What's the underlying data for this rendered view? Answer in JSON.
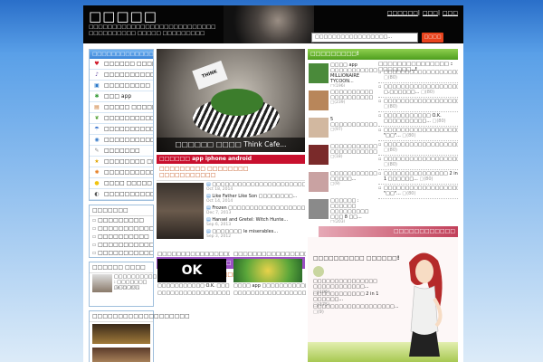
{
  "header": {
    "logo": "□□□□□",
    "tagline": "□□□□□□□□□□□□□□□□□□□□□□□□□□□ □□□□□□□□□□ □□□□□ □□□□□□□□□",
    "links": [
      "□□□□□□",
      "□□□",
      "□□□"
    ],
    "search_placeholder": "□□□□□□□□□□□□□□□□□...",
    "search_button": "□□□□"
  },
  "sidebar": {
    "title": "□□□□□□□□□□□□□",
    "items": [
      {
        "icon": "heart-icon",
        "glyph": "♥",
        "color": "#d11a2a",
        "label": "□□□□□□ □□□□"
      },
      {
        "icon": "music-note-icon",
        "glyph": "♪",
        "color": "#5a3c9c",
        "label": "□□□□□□□□□□"
      },
      {
        "icon": "image-icon",
        "glyph": "▣",
        "color": "#2a78c9",
        "label": "□□□□□□□□□"
      },
      {
        "icon": "apps-icon",
        "glyph": "✱",
        "color": "#3a9c3a",
        "label": "□□□ app"
      },
      {
        "icon": "book-icon",
        "glyph": "▤",
        "color": "#c9742a",
        "label": "□□□□□ □□□□□□□"
      },
      {
        "icon": "leaf-icon",
        "glyph": "❦",
        "color": "#4a9c2a",
        "label": "□□□□□□□□□□□"
      },
      {
        "icon": "umbrella-icon",
        "glyph": "☂",
        "color": "#2a68c9",
        "label": "□□□□□□□□□□□"
      },
      {
        "icon": "globe-icon",
        "glyph": "◉",
        "color": "#3a7cc9",
        "label": "□□□□□□□□□□□"
      },
      {
        "icon": "pin-icon",
        "glyph": "✎",
        "color": "#888888",
        "label": "□□□□□□□"
      },
      {
        "icon": "star-icon",
        "glyph": "★",
        "color": "#e0a400",
        "label": "□□□□□□□□ □□"
      },
      {
        "icon": "sun-icon",
        "glyph": "✺",
        "color": "#e67e22",
        "label": "□□□□□□□□□□□"
      },
      {
        "icon": "bulb-icon",
        "glyph": "●",
        "color": "#f1c40f",
        "label": "□□□□ □□□□□"
      },
      {
        "icon": "speaker-icon",
        "glyph": "◐",
        "color": "#555555",
        "label": "□□□□□□□□□□"
      }
    ]
  },
  "tags": {
    "title": "□□□□□□□",
    "items": [
      "□□□□□□□□□",
      "□□□□□□□□□□□□□□□",
      "□□□□□□□□□□",
      "□□□□□□□□□□□□□□□",
      "□□□□□□□□□□□□□"
    ]
  },
  "left_news": {
    "title": "□□□□□□ □□□□",
    "caption": "□□□□□□□□□□ : □□□□□□□ □□□□□□",
    "date": "Jan 25, 2010"
  },
  "left_video": {
    "title": "□□□□□□□□□□□□□□□□□□□"
  },
  "featured": {
    "caption": "□□□□□□ □□□□ Think Cafe..."
  },
  "redbar": "□□□□□□ app iphone android",
  "news": {
    "title": "□□□□□□□□□ □□□□□□□□ □□□□□□□□□□□",
    "items": [
      {
        "text": "□□□□□□□□□□□□□□□□□□□□□□□□□...",
        "date": "Oct 18, 2014"
      },
      {
        "text": "Like Father Like Son □□□□□□□□...",
        "date": "Oct 14, 2014"
      },
      {
        "text": "Frozen □□□□□□□□□□□□□□□□□□□...",
        "date": "Dec 7, 2013"
      },
      {
        "text": "Hansel and Gretel: Witch Hunte...",
        "date": "Sep 6, 2013"
      },
      {
        "text": "□□□□□□□ le miserables...",
        "date": "Sep 3, 2012"
      }
    ]
  },
  "purple_bar": "□□□□□□□□□□□□□□",
  "sub_header": "□□□□□□□□□□□□□□□□!",
  "bottom_left": {
    "title": "□□□□□□□□□□□□□□□□□□□",
    "rows": [
      "□□□□□□□□□□□ O.K. □□□□□□□□□□...",
      "□□□□□□□□□□□□□□□□□□□□□□..."
    ]
  },
  "bottom_right": {
    "title": "□□□□□□□□□□□□□□□□",
    "rows": [
      "□□□□ app □□□□□□□□□□□ MILLIONAIRE TYCOON...",
      "□□□□□□□□□□□□□□□□□□□□..."
    ]
  },
  "right": {
    "header": "□□□□□□□□□!",
    "col_a": [
      {
        "text": "□□□□ app □□□□□□□□□□□ MILLIONAIRE TYCOON...",
        "count": "□(196)"
      },
      {
        "text": "□□□□□□□□□□ □□□□□□□□□□",
        "count": "□(239)"
      },
      {
        "text": "5 □□□□□□□□□□□□□□□□□□□□□□□□□□□...",
        "count": "□(97)"
      },
      {
        "text": "□□□□□□□□□□□□□□ □□□□□□□□□□□□□...",
        "count": "□(18)"
      },
      {
        "text": "□□□□□□□□□□□□□□□ □□□□□...",
        "count": "□(9)"
      },
      {
        "text": "□□□□□□ : □□□□□□ □□□□□□□□□ □□□ 8 □□...",
        "count": "□(203)"
      }
    ],
    "col_b_title": "□□□□□□□□□□□□□□□ : □□□□□□□..!",
    "col_b": [
      {
        "text": "□□□□□□□□□□□□□□□□□□□□□□□□□□□□□□",
        "count": "□(80)"
      },
      {
        "text": "□□□□□□□□□□□□□□□□□□□ □.□□□□□□...",
        "count": "□(80)"
      },
      {
        "text": "□□□□□□□□□□□□□□□□□□□□□□□□□□□□□□□",
        "count": "□(80)"
      },
      {
        "text": "□□□□□□□□□□□ O.K. □□□□□□□□□□...",
        "count": "□(80)"
      },
      {
        "text": "□□□□□□□□□□□□□□□□□□□□□□□ \"□□\"...",
        "count": "□(80)"
      },
      {
        "text": "□□□□□□□□□□□□□□□□□□□□□□□□□□□□□□",
        "count": "□(80)"
      },
      {
        "text": "□□□□□□□□□□□□□□□□□□□□□□□□□□□□□□",
        "count": "□(80)"
      },
      {
        "text": "□□□□□□□□□□□□□□□ 2 in 1 □□□□□□...",
        "count": "□(80)"
      },
      {
        "text": "□□□□□□□□□□□□□□□□□□□□□□□□□ \"□□\"...",
        "count": "□(80)"
      }
    ],
    "promo_header": "□□□□□□□□□□□□",
    "promo_title": "□□□□□□□□□□ □□□□□□!",
    "promo_items": [
      {
        "text": "□□□□□□□□□□□□□□□ □□□□□□□□□□□□...",
        "count": "□(106)"
      },
      {
        "text": "□□□□□□□□□□□□ 2 in 1 □□□□□□...",
        "count": "□(375)"
      },
      {
        "text": "□□□□□□□□□□□□□□□□□□□...",
        "count": "□(9)"
      }
    ]
  }
}
